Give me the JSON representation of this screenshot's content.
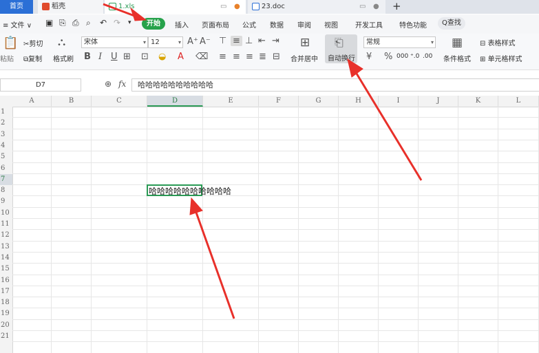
{
  "tabs": {
    "home": "首页",
    "app": "稻壳",
    "xls": "1.xls",
    "doc": "23.doc"
  },
  "menu": {
    "file": "≡ 文件 ∨",
    "start": "开始",
    "insert": "插入",
    "layout": "页面布局",
    "formula": "公式",
    "data": "数据",
    "review": "审阅",
    "view": "视图",
    "dev": "开发工具",
    "special": "特色功能",
    "find": "Q查找"
  },
  "ribbon": {
    "paste": "粘贴",
    "cut": "剪切",
    "copy": "复制",
    "format_painter": "格式刷",
    "font_name": "宋体",
    "font_size": "12",
    "merge_center": "合并居中",
    "wrap_text": "自动换行",
    "number_format": "常规",
    "currency": "¥",
    "percent": "%",
    "thousands": "000",
    "cond_format": "条件格式",
    "table_style": "表格样式",
    "cell_style": "单元格样式"
  },
  "formula_bar": {
    "cell_ref": "D7",
    "fx": "fx",
    "value": "哈哈哈哈哈哈哈哈哈哈"
  },
  "columns": [
    "A",
    "B",
    "C",
    "D",
    "E",
    "F",
    "G",
    "H",
    "I",
    "J",
    "K",
    "L"
  ],
  "selected_column": "D",
  "rows": [
    "1",
    "2",
    "3",
    "4",
    "5",
    "6",
    "7",
    "8",
    "9",
    "10",
    "11",
    "12",
    "13",
    "14",
    "15",
    "16",
    "17",
    "18",
    "19",
    "20",
    "21"
  ],
  "selected_row": "7",
  "cell_d7": "哈哈哈哈哈哈哈哈哈哈",
  "colors": {
    "accent": "#27a24b",
    "arrow": "#e8302a",
    "selection": "#2a9a55"
  }
}
